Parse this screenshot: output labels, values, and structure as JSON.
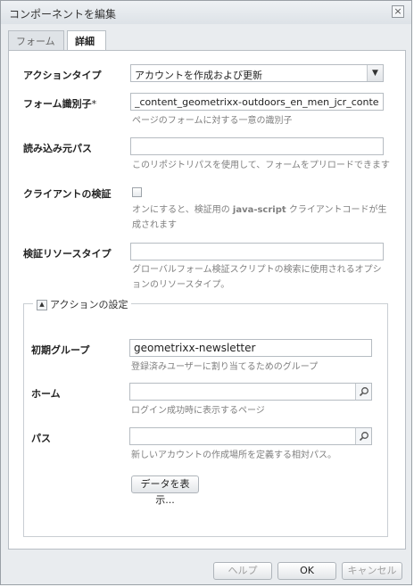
{
  "dialog": {
    "title": "コンポーネントを編集"
  },
  "tabs": [
    {
      "label": "フォーム"
    },
    {
      "label": "詳細"
    }
  ],
  "form": {
    "action_type": {
      "label": "アクションタイプ",
      "value": "アカウントを作成および更新"
    },
    "form_identifier": {
      "label": "フォーム識別子",
      "required_mark": "*",
      "value": "_content_geometrixx-outdoors_en_men_jcr_content_sidebar",
      "help": "ページのフォームに対する一意の識別子"
    },
    "load_path": {
      "label": "読み込み元パス",
      "value": "",
      "help": "このリポジトリパスを使用して、フォームをプリロードできます"
    },
    "client_validation": {
      "label": "クライアントの検証",
      "checked": false,
      "help_prefix": "オンにすると、検証用の ",
      "help_bold": "java-script",
      "help_suffix": " クライアントコードが生成されます"
    },
    "validation_resource_type": {
      "label": "検証リソースタイプ",
      "value": "",
      "help": "グローバルフォーム検証スクリプトの検索に使用されるオプションのリソースタイプ。"
    }
  },
  "action_settings": {
    "legend": "アクションの設定",
    "initial_group": {
      "label": "初期グループ",
      "value": "geometrixx-newsletter",
      "help": "登録済みユーザーに割り当てるためのグループ"
    },
    "home": {
      "label": "ホーム",
      "value": "",
      "help": "ログイン成功時に表示するページ"
    },
    "path": {
      "label": "パス",
      "value": "",
      "help": "新しいアカウントの作成場所を定義する相対パス。"
    },
    "show_data_button": "データを表示..."
  },
  "footer": {
    "help": "ヘルプ",
    "ok": "OK",
    "cancel": "キャンセル"
  },
  "icons": {
    "close": "close-icon",
    "search": "search-icon",
    "collapse": "collapse-icon",
    "dropdown": "chevron-down-icon"
  }
}
